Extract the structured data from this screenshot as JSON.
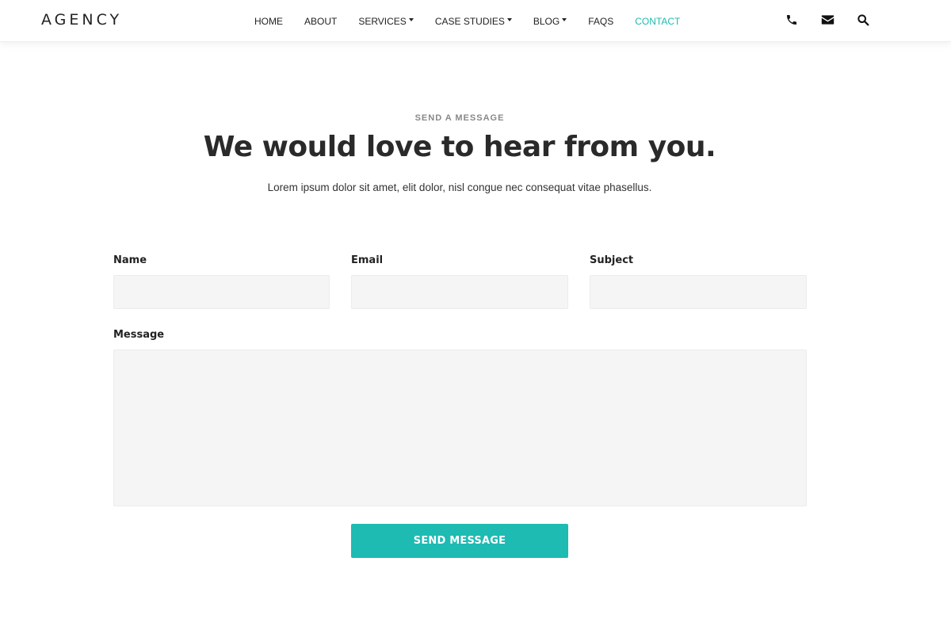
{
  "header": {
    "logo": "AGENCY",
    "nav": [
      {
        "label": "HOME",
        "dropdown": false
      },
      {
        "label": "ABOUT",
        "dropdown": false
      },
      {
        "label": "SERVICES",
        "dropdown": true
      },
      {
        "label": "CASE STUDIES",
        "dropdown": true
      },
      {
        "label": "BLOG",
        "dropdown": true
      },
      {
        "label": "FAQS",
        "dropdown": false
      },
      {
        "label": "CONTACT",
        "dropdown": false,
        "active": true
      }
    ],
    "icons": [
      "phone-icon",
      "envelope-icon",
      "search-icon"
    ]
  },
  "hero": {
    "eyebrow": "SEND A MESSAGE",
    "title": "We would love to hear from you.",
    "subtitle": "Lorem ipsum dolor sit amet, elit dolor, nisl congue nec consequat vitae phasellus."
  },
  "form": {
    "name_label": "Name",
    "name_value": "",
    "email_label": "Email",
    "email_value": "",
    "subject_label": "Subject",
    "subject_value": "",
    "message_label": "Message",
    "message_value": "",
    "submit_label": "SEND MESSAGE"
  },
  "colors": {
    "accent": "#1dbbb2",
    "text_dark": "#2a2a2a",
    "field_bg": "#f5f5f5"
  }
}
